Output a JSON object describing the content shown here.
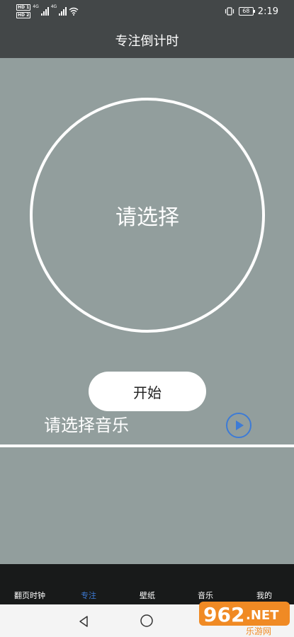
{
  "status_bar": {
    "sim1": "HD 1",
    "sim2": "HD 2",
    "net1": "4G",
    "net2": "4G",
    "battery": "68",
    "time": "2:19"
  },
  "header": {
    "title": "专注倒计时"
  },
  "timer": {
    "label": "请选择"
  },
  "start_button": {
    "label": "开始"
  },
  "music": {
    "label": "请选择音乐"
  },
  "tabs": [
    {
      "label": "翻页时钟",
      "active": false
    },
    {
      "label": "专注",
      "active": true
    },
    {
      "label": "壁纸",
      "active": false
    },
    {
      "label": "音乐",
      "active": false
    },
    {
      "label": "我的",
      "active": false
    }
  ],
  "watermark": {
    "brand": "962",
    "suffix": ".NET",
    "caption": "乐游网"
  },
  "colors": {
    "accent": "#3d7bd6",
    "background": "#929e9d",
    "header": "#434748",
    "tab_bar": "#181a1a",
    "watermark_orange": "#f08a24"
  }
}
